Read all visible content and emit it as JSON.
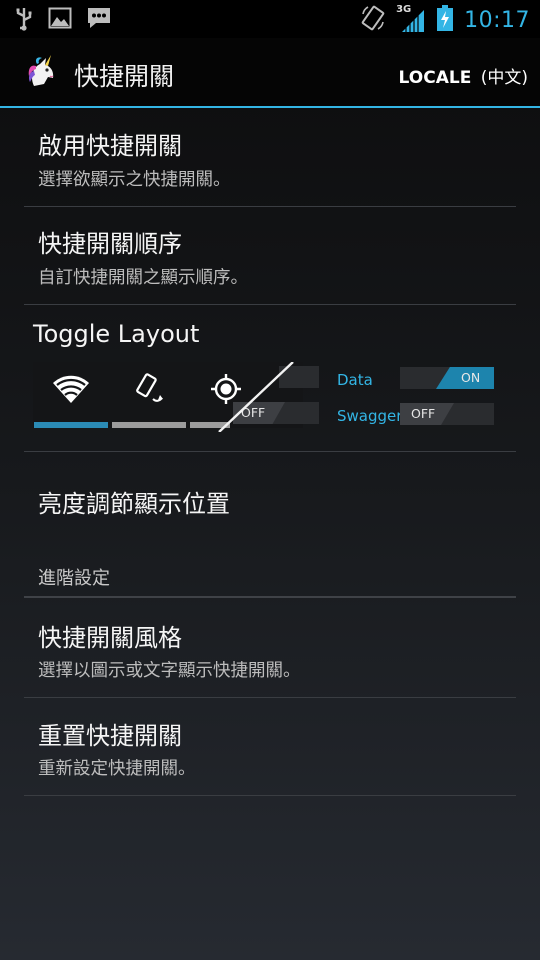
{
  "status_bar": {
    "network": "3G",
    "time": "10:17",
    "icons": [
      "usb-icon",
      "image-icon",
      "chat-icon",
      "rotation-icon",
      "signal-icon",
      "battery-charging-icon"
    ]
  },
  "action_bar": {
    "title": "快捷開關",
    "locale_label": "LOCALE",
    "locale_paren_open": "(",
    "locale_value": "中文",
    "locale_paren_close": ")",
    "app_icon": "unicorn-icon"
  },
  "settings": [
    {
      "title": "啟用快捷開關",
      "summary": "選擇欲顯示之快捷開關。"
    },
    {
      "title": "快捷開關順序",
      "summary": "自訂快捷開關之顯示順序。"
    }
  ],
  "toggle_layout": {
    "title": "Toggle Layout",
    "icons": [
      "wifi-icon",
      "auto-rotate-icon",
      "gps-icon"
    ],
    "switches": [
      {
        "label": "Data",
        "state": "ON"
      },
      {
        "label": "Swagger",
        "state": "OFF"
      }
    ],
    "hidden_switch_state": "OFF"
  },
  "brightness": {
    "title": "亮度調節顯示位置"
  },
  "category": {
    "label": "進階設定"
  },
  "advanced": [
    {
      "title": "快捷開關風格",
      "summary": "選擇以圖示或文字顯示快捷開關。"
    },
    {
      "title": "重置快捷開關",
      "summary": "重新設定快捷開關。"
    }
  ],
  "colors": {
    "accent": "#33b5e5",
    "switch_on": "#1d84ad",
    "bar_active": "#2b8bb5",
    "bar_inactive": "#9c9c9c"
  }
}
